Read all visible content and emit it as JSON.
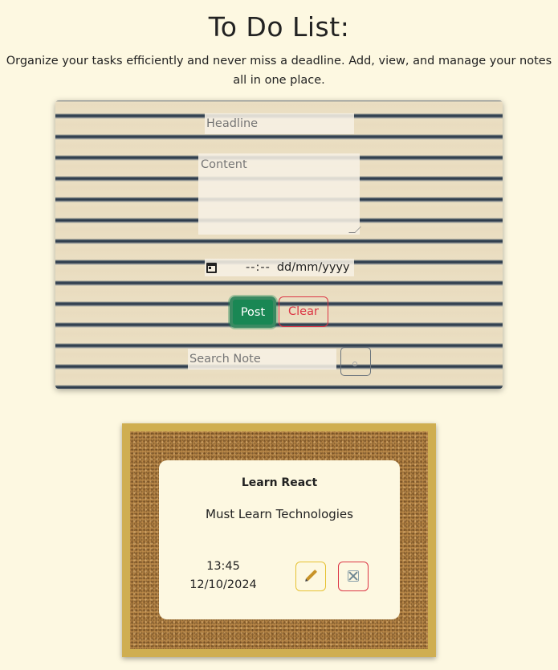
{
  "header": {
    "title": "To Do List:",
    "subtitle": "Organize your tasks efficiently and never miss a deadline. Add, view, and manage your notes all in one place."
  },
  "form": {
    "headline_placeholder": "Headline",
    "content_placeholder": "Content",
    "datetime_time": "--:--",
    "datetime_date": "dd/mm/yyyy",
    "post_label": "Post",
    "clear_label": "Clear",
    "search_placeholder": "Search Note"
  },
  "notes": [
    {
      "title": "Learn React",
      "content": "Must Learn Technologies",
      "time": "13:45",
      "date": "12/10/2024"
    }
  ],
  "colors": {
    "page_background": "#fdf8e1",
    "post_button": "#198754",
    "clear_button": "#dc3545",
    "edit_button_border": "#e6c233",
    "board_frame": "#cfae51"
  },
  "icons": [
    "calendar-icon",
    "search-icon",
    "pencil-icon",
    "close-icon"
  ]
}
